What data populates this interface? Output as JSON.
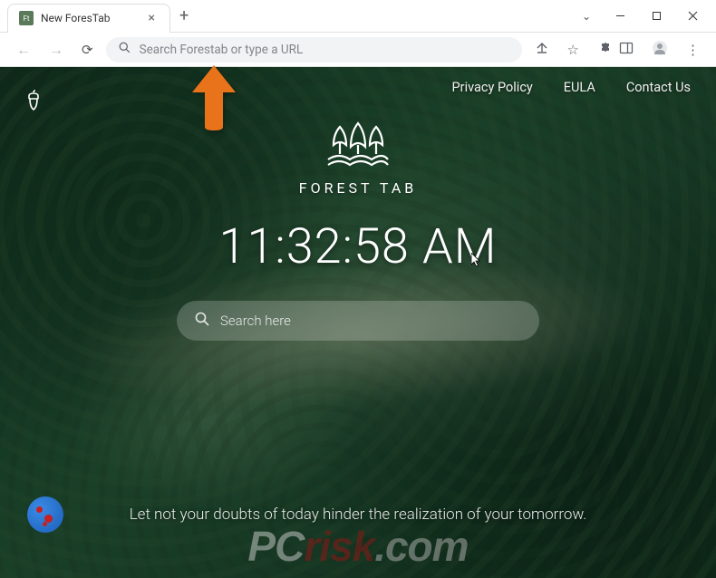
{
  "window": {
    "tab_title": "New ForesTab",
    "chevron": "⌄"
  },
  "addressbar": {
    "placeholder": "Search Forestab or type a URL"
  },
  "nav": {
    "privacy": "Privacy Policy",
    "eula": "EULA",
    "contact": "Contact Us"
  },
  "logo": {
    "text": "FOREST TAB"
  },
  "clock": {
    "time": "11:32:58 AM"
  },
  "search": {
    "placeholder": "Search here"
  },
  "quote": {
    "text": "Let not your doubts of today hinder the realization of your tomorrow."
  },
  "watermark": {
    "pc": "PC",
    "risk": "risk",
    "com": ".com"
  }
}
